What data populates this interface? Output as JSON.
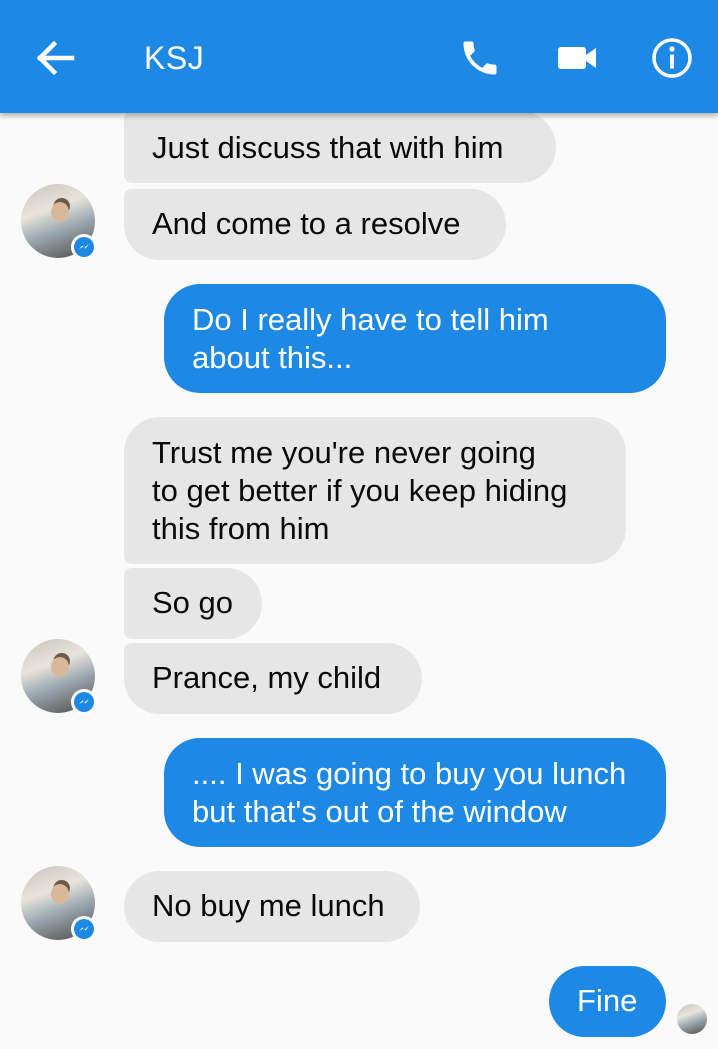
{
  "header": {
    "title": "KSJ",
    "icons": {
      "back": "arrow-left-icon",
      "call": "phone-icon",
      "video": "video-camera-icon",
      "info": "info-icon"
    },
    "colors": {
      "bar": "#1e88e5",
      "icon": "#ffffff"
    }
  },
  "messages": [
    {
      "sender": "contact",
      "lines": [
        "Just discuss that with him"
      ]
    },
    {
      "sender": "contact",
      "lines": [
        "And come to a resolve"
      ]
    },
    {
      "sender": "me",
      "lines": [
        "Do I really have to tell him",
        "about this..."
      ]
    },
    {
      "sender": "contact",
      "lines": [
        "Trust me you're never going",
        "to get better if you keep hiding",
        "this from him"
      ]
    },
    {
      "sender": "contact",
      "lines": [
        "So go"
      ]
    },
    {
      "sender": "contact",
      "lines": [
        "Prance, my child"
      ]
    },
    {
      "sender": "me",
      "lines": [
        ".... I was going to buy you lunch",
        "but that's out of the window"
      ]
    },
    {
      "sender": "contact",
      "lines": [
        "No buy me lunch"
      ]
    },
    {
      "sender": "me",
      "lines": [
        "Fine"
      ]
    }
  ],
  "colors": {
    "incoming_bubble": "#e6e6e6",
    "outgoing_bubble": "#1e88e5",
    "background": "#fafafa"
  }
}
